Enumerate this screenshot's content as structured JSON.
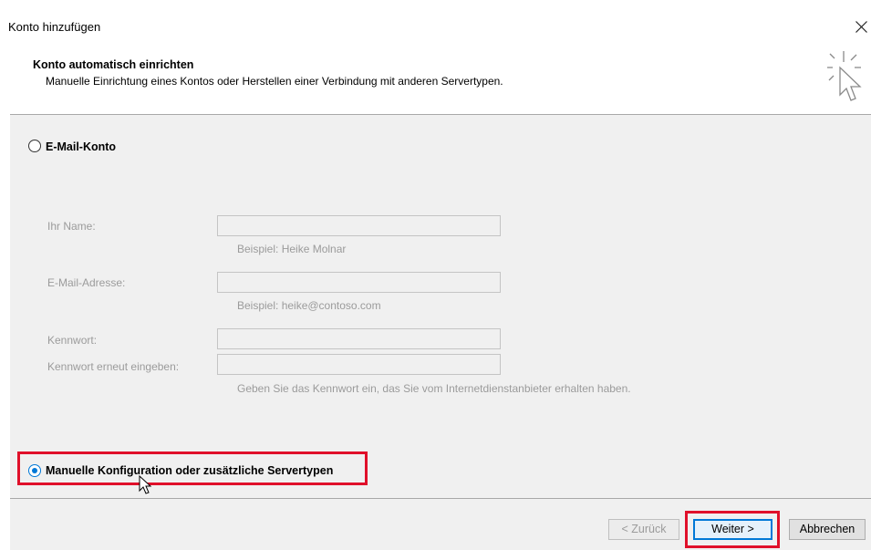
{
  "window": {
    "title": "Konto hinzufügen",
    "close_icon": "close-icon"
  },
  "header": {
    "title": "Konto automatisch einrichten",
    "subtitle": "Manuelle Einrichtung eines Kontos oder Herstellen einer Verbindung mit anderen Servertypen.",
    "icon": "sparkle-cursor-icon"
  },
  "options": {
    "email_account": {
      "label": "E-Mail-Konto",
      "checked": false
    },
    "manual_config": {
      "label": "Manuelle Konfiguration oder zusätzliche Servertypen",
      "checked": true
    }
  },
  "form": {
    "name": {
      "label": "Ihr Name:",
      "value": "",
      "hint": "Beispiel: Heike Molnar"
    },
    "email": {
      "label": "E-Mail-Adresse:",
      "value": "",
      "hint": "Beispiel: heike@contoso.com"
    },
    "password": {
      "label": "Kennwort:",
      "value": ""
    },
    "password_repeat": {
      "label": "Kennwort erneut eingeben:",
      "value": "",
      "hint": "Geben Sie das Kennwort ein, das Sie vom Internetdienstanbieter erhalten haben."
    }
  },
  "footer": {
    "back_label": "< Zurück",
    "next_label": "Weiter >",
    "cancel_label": "Abbrechen"
  },
  "colors": {
    "accent": "#0078d7",
    "highlight": "#e0102a",
    "panel": "#f0f0f0",
    "disabled_text": "#9b9b9b"
  }
}
